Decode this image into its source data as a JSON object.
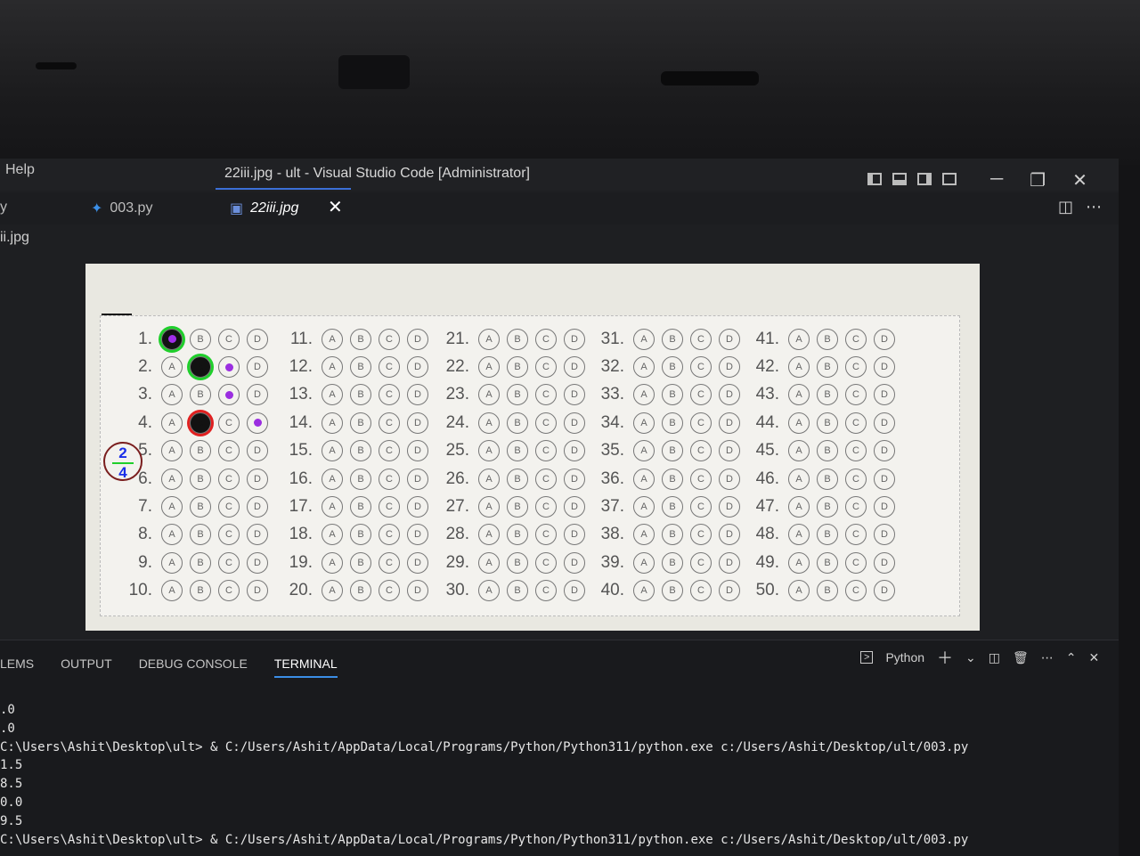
{
  "titlebar": {
    "help": "Help",
    "window_title": "22iii.jpg - ult - Visual Studio Code [Administrator]"
  },
  "tabs": [
    {
      "label": "003.py",
      "icon": "python-icon",
      "active": false
    },
    {
      "label": "22iii.jpg",
      "icon": "image-icon",
      "active": true
    }
  ],
  "breadcrumb": "ii.jpg",
  "image": {
    "columns": [
      {
        "start": 1,
        "labels": [
          "1.",
          "2.",
          "3.",
          "4.",
          "5.",
          "6.",
          "7.",
          "8.",
          "9.",
          "10."
        ]
      },
      {
        "start": 11,
        "labels": [
          "11.",
          "12.",
          "13.",
          "14.",
          "15.",
          "16.",
          "17.",
          "18.",
          "19.",
          "20."
        ]
      },
      {
        "start": 21,
        "labels": [
          "21.",
          "22.",
          "23.",
          "24.",
          "25.",
          "26.",
          "27.",
          "28.",
          "29.",
          "30."
        ]
      },
      {
        "start": 31,
        "labels": [
          "31.",
          "32.",
          "33.",
          "34.",
          "35.",
          "36.",
          "37.",
          "38.",
          "39.",
          "40."
        ]
      },
      {
        "start": 41,
        "labels": [
          "41.",
          "42.",
          "43.",
          "44.",
          "45.",
          "46.",
          "47.",
          "48.",
          "49.",
          "50."
        ]
      }
    ],
    "options": [
      "A",
      "B",
      "C",
      "D"
    ],
    "score": {
      "numerator": "2",
      "denominator": "4"
    },
    "marks": {
      "filled": [
        "1-A",
        "2-B",
        "4-B"
      ],
      "ring_green": [
        "1-A",
        "2-B"
      ],
      "ring_red": [
        "4-B"
      ],
      "dot": [
        "1-A",
        "2-C",
        "3-C",
        "4-D"
      ]
    },
    "colors": {
      "correct": "#1fcf2b",
      "wrong": "#e02020",
      "answer_dot": "#9b2ee0",
      "score_text": "#1a2ee8"
    }
  },
  "panel": {
    "tabs": [
      "LEMS",
      "OUTPUT",
      "DEBUG CONSOLE",
      "TERMINAL"
    ],
    "active_tab": "TERMINAL",
    "terminal_shell": "Python",
    "terminal_lines": [
      ".0",
      ".0",
      "C:\\Users\\Ashit\\Desktop\\ult> & C:/Users/Ashit/AppData/Local/Programs/Python/Python311/python.exe c:/Users/Ashit/Desktop/ult/003.py",
      "1.5",
      "8.5",
      "0.0",
      "9.5",
      "C:\\Users\\Ashit\\Desktop\\ult> & C:/Users/Ashit/AppData/Local/Programs/Python/Python311/python.exe c:/Users/Ashit/Desktop/ult/003.py"
    ]
  }
}
